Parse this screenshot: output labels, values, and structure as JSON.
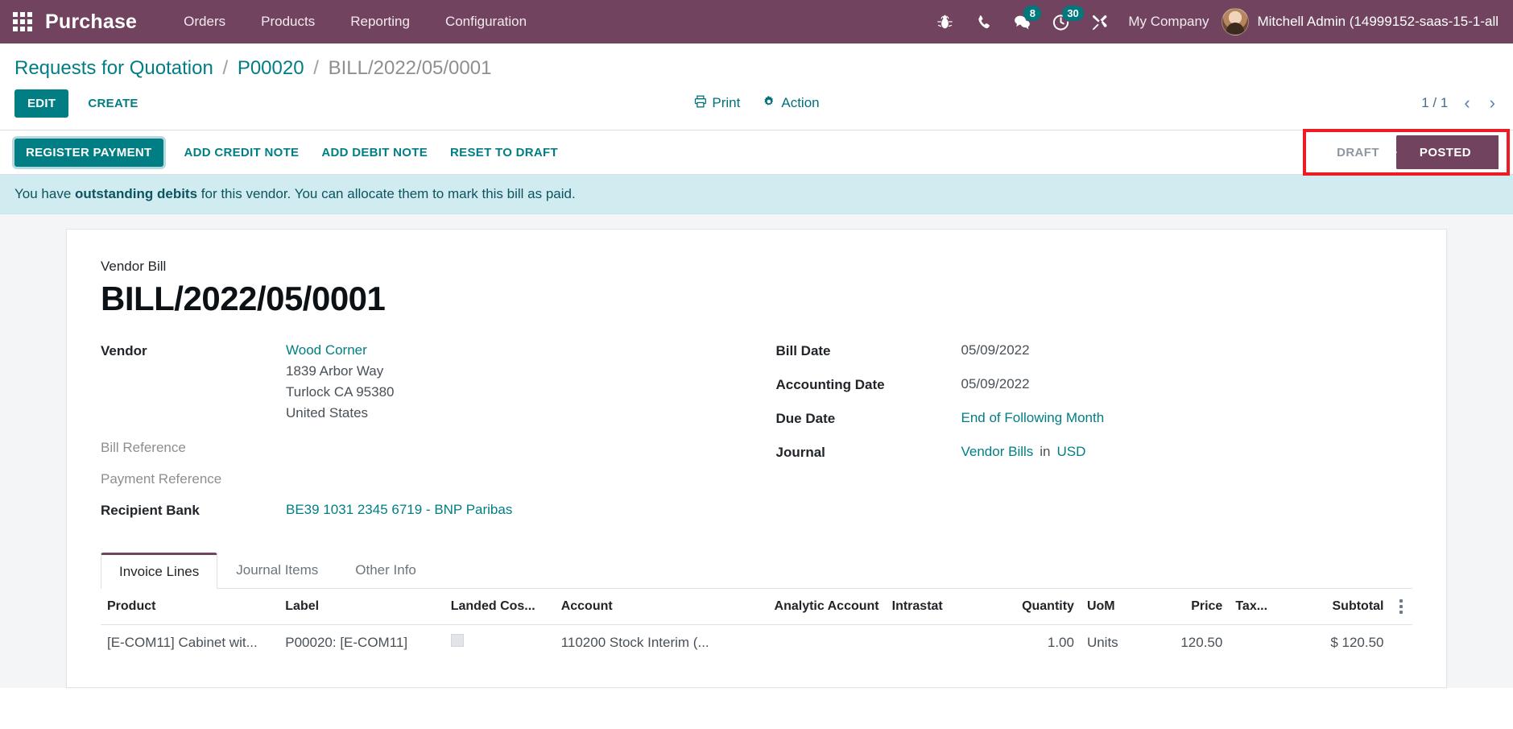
{
  "navbar": {
    "apps_icon": "apps-grid-icon",
    "brand": "Purchase",
    "menu": [
      {
        "label": "Orders"
      },
      {
        "label": "Products"
      },
      {
        "label": "Reporting"
      },
      {
        "label": "Configuration"
      }
    ],
    "icons": [
      {
        "name": "bug-icon",
        "badge": null
      },
      {
        "name": "phone-icon",
        "badge": null
      },
      {
        "name": "messages-icon",
        "badge": "8"
      },
      {
        "name": "activity-clock-icon",
        "badge": "30"
      },
      {
        "name": "tools-wrench-icon",
        "badge": null
      }
    ],
    "company": "My Company",
    "user": "Mitchell Admin (14999152-saas-15-1-all",
    "bg_color": "#71435f",
    "badge_color": "#00787d"
  },
  "breadcrumb": {
    "items": [
      {
        "label": "Requests for Quotation",
        "current": false
      },
      {
        "label": "P00020",
        "current": false
      },
      {
        "label": "BILL/2022/05/0001",
        "current": true
      }
    ],
    "separator": "/"
  },
  "control_bar": {
    "edit_label": "EDIT",
    "create_label": "CREATE",
    "print_label": "Print",
    "action_label": "Action",
    "pager_text": "1 / 1",
    "prev_icon": "chevron-left-icon",
    "next_icon": "chevron-right-icon"
  },
  "status_row": {
    "buttons": [
      {
        "label": "REGISTER PAYMENT",
        "primary": true
      },
      {
        "label": "ADD CREDIT NOTE",
        "primary": false
      },
      {
        "label": "ADD DEBIT NOTE",
        "primary": false
      },
      {
        "label": "RESET TO DRAFT",
        "primary": false
      }
    ],
    "stages": [
      {
        "label": "DRAFT",
        "active": false
      },
      {
        "label": "POSTED",
        "active": true
      }
    ],
    "highlight_color": "#ed1c24"
  },
  "alert": {
    "text_before": "You have ",
    "link_text": "outstanding debits",
    "text_after": " for this vendor. You can allocate them to mark this bill as paid."
  },
  "sheet": {
    "doc_type": "Vendor Bill",
    "doc_title": "BILL/2022/05/0001",
    "left_fields": [
      {
        "label": "Vendor",
        "muted": false,
        "value": "Wood Corner",
        "value_is_link": true,
        "extra_lines": [
          "1839 Arbor Way",
          "Turlock CA 95380",
          "United States"
        ]
      },
      {
        "label": "Bill Reference",
        "muted": true,
        "value": "",
        "value_is_link": false,
        "extra_lines": []
      },
      {
        "label": "Payment Reference",
        "muted": true,
        "value": "",
        "value_is_link": false,
        "extra_lines": []
      },
      {
        "label": "Recipient Bank",
        "muted": false,
        "value": "BE39 1031 2345 6719 - BNP Paribas",
        "value_is_link": true,
        "extra_lines": []
      }
    ],
    "right_fields": [
      {
        "label": "Bill Date",
        "value": "05/09/2022",
        "value_is_link": false
      },
      {
        "label": "Accounting Date",
        "value": "05/09/2022",
        "value_is_link": false
      },
      {
        "label": "Due Date",
        "value": "End of Following Month",
        "value_is_link": true
      },
      {
        "label": "Journal",
        "value": "Vendor Bills",
        "value_is_link": true,
        "mid": "in",
        "value2": "USD"
      }
    ],
    "tabs": [
      {
        "label": "Invoice Lines",
        "active": true
      },
      {
        "label": "Journal Items",
        "active": false
      },
      {
        "label": "Other Info",
        "active": false
      }
    ],
    "table": {
      "columns": [
        {
          "label": "Product",
          "align": "left"
        },
        {
          "label": "Label",
          "align": "left"
        },
        {
          "label": "Landed Cos...",
          "align": "left"
        },
        {
          "label": "Account",
          "align": "left"
        },
        {
          "label": "Analytic Account",
          "align": "right"
        },
        {
          "label": "Intrastat",
          "align": "left"
        },
        {
          "label": "Quantity",
          "align": "right"
        },
        {
          "label": "UoM",
          "align": "left"
        },
        {
          "label": "Price",
          "align": "right"
        },
        {
          "label": "Tax...",
          "align": "left"
        },
        {
          "label": "Subtotal",
          "align": "right"
        }
      ],
      "options_icon": "options-dots-icon",
      "rows": [
        {
          "product": "[E-COM11] Cabinet wit...",
          "label": "P00020: [E-COM11]",
          "landed_cost": "",
          "account": "110200 Stock Interim (...",
          "analytic_account": "",
          "intrastat": "",
          "quantity": "1.00",
          "uom": "Units",
          "price": "120.50",
          "tax": "",
          "subtotal": "$ 120.50"
        }
      ]
    }
  }
}
